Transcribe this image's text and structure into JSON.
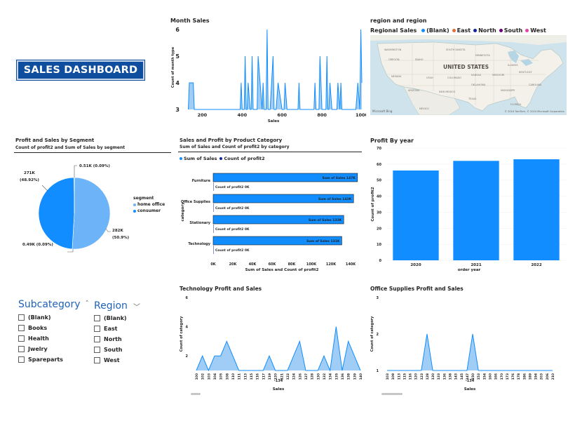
{
  "dashboard": {
    "title": "SALES DASHBOARD"
  },
  "month_sales": {
    "title": "Month Sales",
    "xlabel": "Sales",
    "ylabel": "Count of month type",
    "x_ticks": [
      "200",
      "400",
      "600",
      "800",
      "1000"
    ],
    "y_ticks": [
      "3",
      "4",
      "5",
      "6"
    ]
  },
  "region_map": {
    "title": "region and region",
    "legend_title": "Regional Sales",
    "legend": [
      {
        "label": "(Blank)",
        "color": "#118dff"
      },
      {
        "label": "East",
        "color": "#e66c37"
      },
      {
        "label": "North",
        "color": "#12239e"
      },
      {
        "label": "South",
        "color": "#6b007b"
      },
      {
        "label": "West",
        "color": "#e044a7"
      }
    ],
    "country_label": "UNITED STATES",
    "attribution": "© 2024 TomTom, © 2024 Microsoft Corporation",
    "brand": "Microsoft Bing"
  },
  "segment_pie": {
    "title": "Profit and Sales by Segment",
    "subtitle": "Count of profit2 and Sum of Sales by segment",
    "labels": [
      "0.51K (0.09%)",
      "271K\n(48.92%)",
      "282K\n(50.9%)",
      "0.49K (0.09%)"
    ],
    "legend_title": "segment",
    "legend": [
      {
        "label": "home office",
        "color": "#6cb4f7"
      },
      {
        "label": "consumer",
        "color": "#118dff"
      }
    ]
  },
  "category_bar": {
    "title": "Sales and Profit by Product Category",
    "subtitle": "Sum of Sales and Count of profit2 by category",
    "legend": [
      {
        "label": "Sum of Sales",
        "color": "#118dff"
      },
      {
        "label": "Count of profit2",
        "color": "#12239e"
      }
    ],
    "ylabel": "category",
    "xlabel": "Sum of Sales and Count of profit2",
    "x_ticks": [
      "0K",
      "20K",
      "40K",
      "60K",
      "80K",
      "100K",
      "120K",
      "140K"
    ],
    "categories": [
      "Furniture",
      "Office Supplies",
      "Stationary",
      "Technology"
    ],
    "sales_labels": [
      "Sum of Sales 147K",
      "Sum of Sales 143K",
      "Sum of Sales 133K",
      "Sum of Sales 131K"
    ],
    "profit_labels": [
      "Count of profit2 0K",
      "Count of profit2 0K",
      "Count of profit2 0K",
      "Count of profit2 0K"
    ]
  },
  "profit_year": {
    "title": "Profit By year",
    "ylabel": "Count of profit2",
    "xlabel": "order year",
    "y_ticks": [
      "0",
      "10",
      "20",
      "30",
      "40",
      "50",
      "60",
      "70"
    ],
    "x_ticks": [
      "2020",
      "2021",
      "2022"
    ]
  },
  "subcategory_slicer": {
    "title": "Subcategory",
    "items": [
      "(Blank)",
      "Books",
      "Health",
      "Jwelry",
      "Spareparts"
    ]
  },
  "region_slicer": {
    "title": "Region",
    "items": [
      "(Blank)",
      "East",
      "North",
      "South",
      "West"
    ]
  },
  "tech_area": {
    "title": "Technology Profit and Sales",
    "ylabel": "Count of category",
    "xlabel": "Sales",
    "y_ticks": [
      "2",
      "4",
      "6"
    ],
    "x_ticks": [
      "100",
      "102",
      "103",
      "104",
      "105",
      "108",
      "110",
      "111",
      "113",
      "115",
      "116",
      "117",
      "119",
      "120",
      "121",
      "122",
      "124",
      "126",
      "127",
      "128",
      "130",
      "132",
      "134",
      "135",
      "136",
      "138",
      "139",
      "140"
    ],
    "extra_tick": "-134"
  },
  "office_area": {
    "title": "Office Supplies Profit and Sales",
    "ylabel": "Count of category",
    "xlabel": "Sales",
    "y_ticks": [
      "1",
      "2",
      "3"
    ],
    "x_ticks": [
      "103",
      "109",
      "113",
      "115",
      "116",
      "120",
      "123",
      "128",
      "130",
      "133",
      "136",
      "138",
      "143",
      "145",
      "147",
      "150",
      "153",
      "154",
      "160",
      "166",
      "170",
      "173",
      "176",
      "178",
      "186",
      "189",
      "194",
      "203",
      "206",
      "210"
    ],
    "extra_tick": "-134"
  },
  "chart_data": [
    {
      "type": "area",
      "title": "Month Sales",
      "xlabel": "Sales",
      "ylabel": "Count of month type",
      "xlim": [
        100,
        1000
      ],
      "ylim": [
        3,
        6
      ],
      "x": [
        130,
        135,
        155,
        160,
        390,
        395,
        400,
        410,
        415,
        420,
        425,
        430,
        440,
        445,
        450,
        455,
        460,
        475,
        480,
        500,
        505,
        510,
        520,
        525,
        530,
        540,
        555,
        560,
        570,
        580,
        600,
        610,
        615,
        625,
        630,
        680,
        685,
        690,
        700,
        760,
        765,
        770,
        785,
        790,
        800,
        820,
        825,
        830,
        835,
        840,
        850,
        860,
        875,
        880,
        890,
        895,
        900,
        905,
        970,
        980,
        990,
        995,
        1000
      ],
      "y": [
        3,
        4,
        4,
        3,
        3,
        4,
        3,
        3,
        5,
        3,
        3,
        4,
        3,
        3,
        5,
        3,
        3,
        3,
        5,
        3,
        4,
        3,
        3,
        6,
        3,
        3,
        5,
        3,
        3,
        4,
        3,
        3,
        4,
        3,
        3,
        3,
        4,
        3,
        3,
        3,
        4,
        3,
        3,
        5,
        3,
        3,
        5,
        3,
        3,
        4,
        3,
        3,
        3,
        4,
        3,
        4,
        3,
        3,
        3,
        4,
        3,
        6,
        4
      ]
    },
    {
      "type": "pie",
      "title": "Profit and Sales by Segment",
      "slices": [
        {
          "label": "home office",
          "value": 282,
          "percent": 50.9
        },
        {
          "label": "consumer",
          "value": 271,
          "percent": 48.92
        },
        {
          "label": "",
          "value": 0.51,
          "percent": 0.09
        },
        {
          "label": "",
          "value": 0.49,
          "percent": 0.09
        }
      ]
    },
    {
      "type": "bar",
      "orientation": "horizontal",
      "title": "Sales and Profit by Product Category",
      "categories": [
        "Furniture",
        "Office Supplies",
        "Stationary",
        "Technology"
      ],
      "xlim": [
        0,
        140000
      ],
      "series": [
        {
          "name": "Sum of Sales",
          "values": [
            147000,
            143000,
            133000,
            131000
          ]
        },
        {
          "name": "Count of profit2",
          "values": [
            0,
            0,
            0,
            0
          ]
        }
      ]
    },
    {
      "type": "bar",
      "title": "Profit By year",
      "categories": [
        "2020",
        "2021",
        "2022"
      ],
      "values": [
        56,
        62,
        63
      ],
      "ylim": [
        0,
        70
      ],
      "xlabel": "order year",
      "ylabel": "Count of profit2"
    },
    {
      "type": "area",
      "title": "Technology Profit and Sales",
      "xlabel": "Sales",
      "ylabel": "Count of category",
      "categories": [
        "100",
        "102",
        "103",
        "104",
        "105",
        "108",
        "110",
        "111",
        "113",
        "115",
        "116",
        "117",
        "119",
        "120",
        "121",
        "122",
        "124",
        "126",
        "127",
        "128",
        "130",
        "132",
        "134",
        "135",
        "136",
        "138",
        "139",
        "140"
      ],
      "values": [
        1,
        2,
        1,
        2,
        2,
        3,
        2,
        1,
        1,
        1,
        1,
        1,
        2,
        1,
        1,
        1,
        2,
        3,
        1,
        1,
        1,
        2,
        1,
        4,
        1,
        3,
        2,
        1
      ],
      "ylim": [
        1,
        6
      ]
    },
    {
      "type": "area",
      "title": "Office Supplies Profit and Sales",
      "xlabel": "Sales",
      "ylabel": "Count of category",
      "categories": [
        "103",
        "109",
        "113",
        "115",
        "116",
        "120",
        "123",
        "128",
        "130",
        "133",
        "136",
        "138",
        "143",
        "145",
        "147",
        "150",
        "153",
        "154",
        "160",
        "166",
        "170",
        "173",
        "176",
        "178",
        "186",
        "189",
        "194",
        "203",
        "206",
        "210"
      ],
      "values": [
        1,
        1,
        1,
        1,
        1,
        1,
        1,
        2,
        1,
        1,
        1,
        1,
        1,
        1,
        1,
        2,
        1,
        1,
        1,
        1,
        1,
        1,
        1,
        1,
        1,
        1,
        1,
        1,
        1,
        1
      ],
      "ylim": [
        1,
        3
      ]
    }
  ]
}
